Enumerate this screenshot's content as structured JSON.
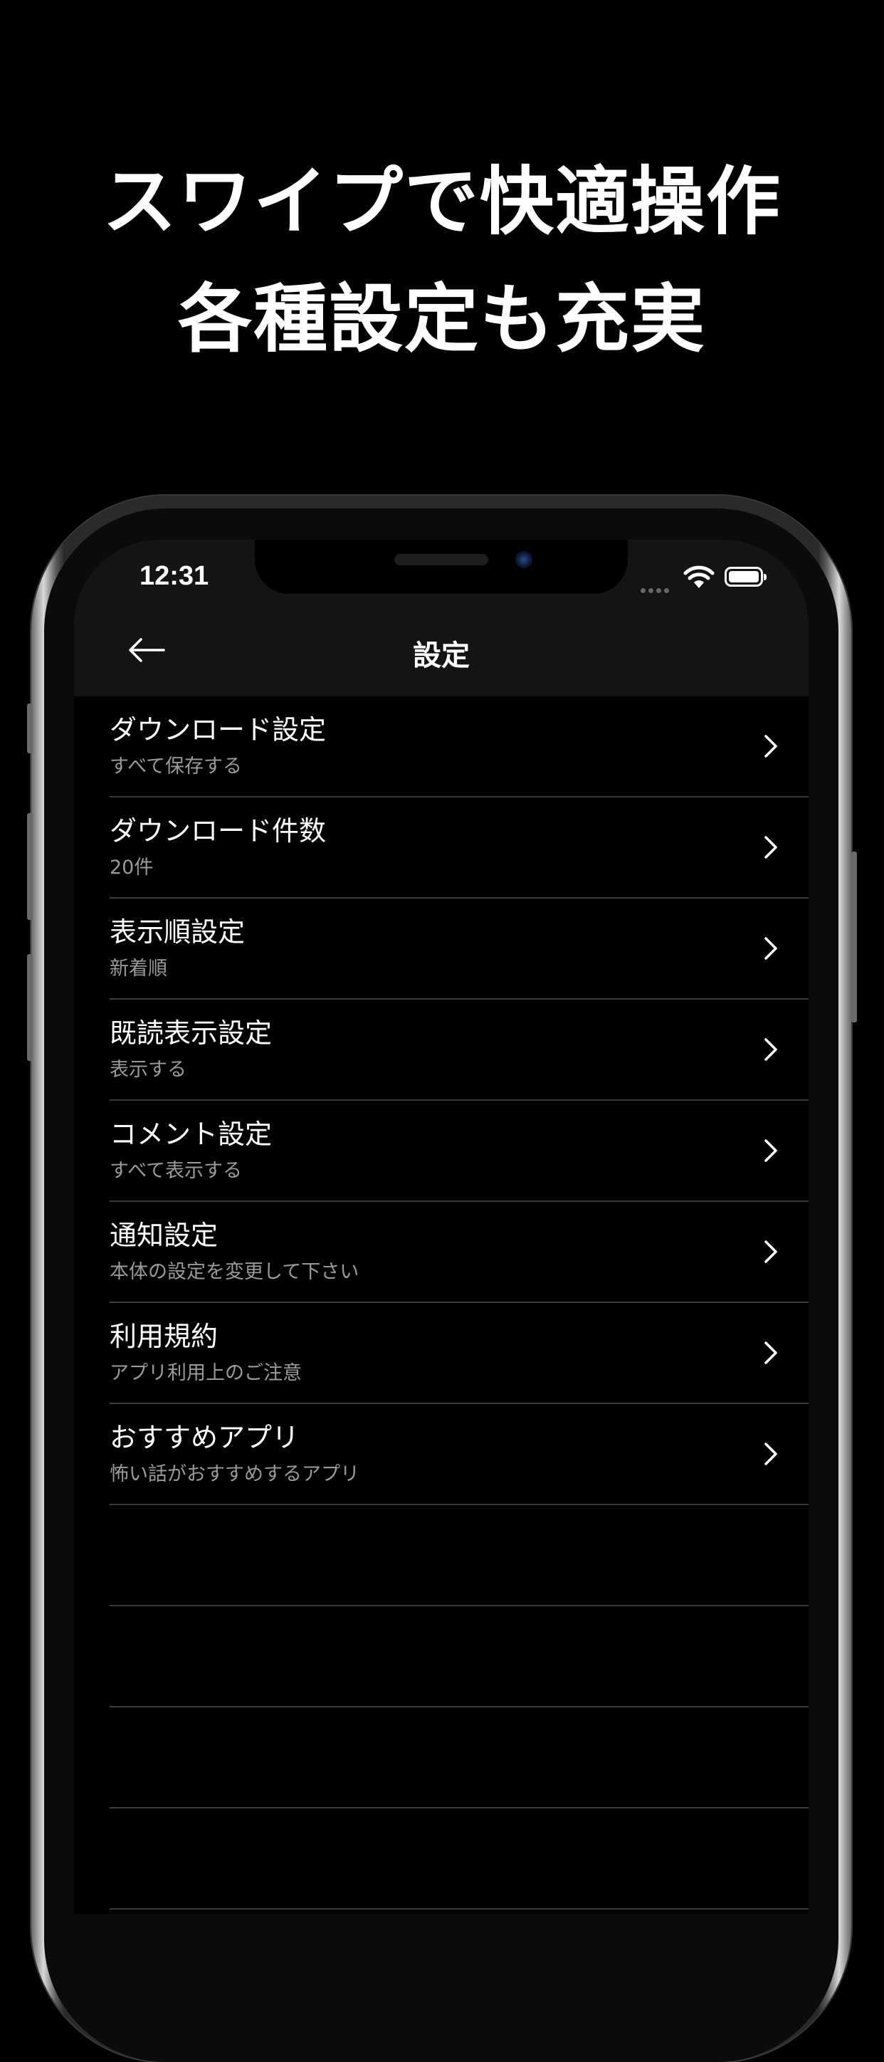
{
  "promo": {
    "line1": "スワイプで快適操作",
    "line2": "各種設定も充実"
  },
  "status_bar": {
    "time": "12:31",
    "icons": [
      "signal-dots-icon",
      "wifi-icon",
      "battery-icon"
    ]
  },
  "nav": {
    "title": "設定",
    "back_icon": "back-arrow-icon"
  },
  "settings": [
    {
      "title": "ダウンロード設定",
      "subtitle": "すべて保存する"
    },
    {
      "title": "ダウンロード件数",
      "subtitle": "20件"
    },
    {
      "title": "表示順設定",
      "subtitle": "新着順"
    },
    {
      "title": "既読表示設定",
      "subtitle": "表示する"
    },
    {
      "title": "コメント設定",
      "subtitle": "すべて表示する"
    },
    {
      "title": "通知設定",
      "subtitle": "本体の設定を変更して下さい"
    },
    {
      "title": "利用規約",
      "subtitle": "アプリ利用上のご注意"
    },
    {
      "title": "おすすめアプリ",
      "subtitle": "怖い話がおすすめするアプリ"
    }
  ],
  "colors": {
    "background": "#000000",
    "nav_background": "#141414",
    "separator": "#3a3a3a",
    "subtitle": "#9a9a9a"
  }
}
